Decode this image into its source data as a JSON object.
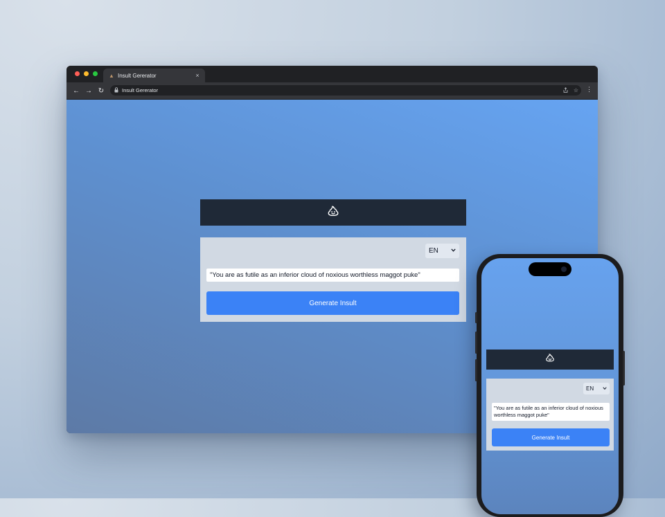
{
  "browser": {
    "tab_title": "Insult Gererator",
    "tab_close": "×",
    "url": "Insult Gererator",
    "nav": {
      "back": "←",
      "forward": "→",
      "reload": "↻"
    },
    "menu": "⋮",
    "dot_colors": [
      "#ff5f57",
      "#febc2e",
      "#28c840"
    ]
  },
  "app": {
    "logo_icon": "poop-emoji-icon",
    "language": {
      "selected": "EN",
      "chevron": "⌄"
    },
    "insult_text": "\"You are as futile as an inferior cloud of noxious worthless maggot puke\"",
    "generate_label": "Generate Insult"
  },
  "mobile": {
    "language": {
      "selected": "EN",
      "chevron": "⌄"
    },
    "insult_text": "\"You are as futile as an inferior cloud of noxious worthless maggot puke\"",
    "generate_label": "Generate Insult"
  },
  "colors": {
    "header_bg": "#1f2937",
    "card_bg": "#d1d9e3",
    "button_bg": "#3b82f6"
  }
}
